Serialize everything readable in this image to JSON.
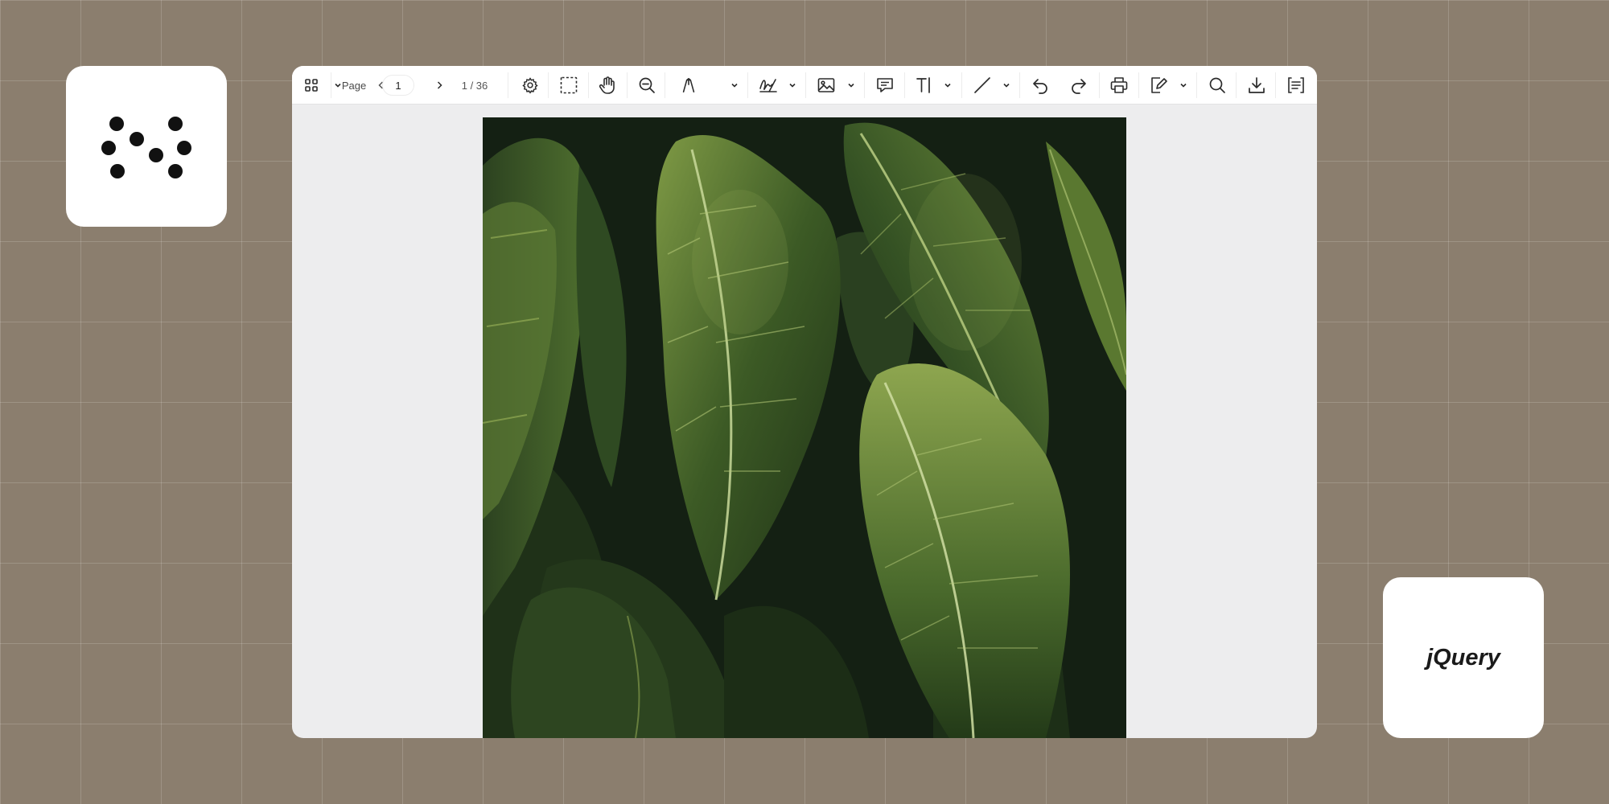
{
  "brand_right": {
    "text": "jQuery"
  },
  "toolbar": {
    "page_label": "Page",
    "page_value": "1",
    "page_total": "1 / 36",
    "icons": [
      "grid-icon",
      "chevron-down-icon",
      "chevron-left-icon",
      "chevron-right-icon",
      "gear-icon",
      "marquee-select-icon",
      "hand-icon",
      "zoom-out-icon",
      "pen-icon",
      "signature-icon",
      "image-icon",
      "comment-icon",
      "text-icon",
      "line-icon",
      "undo-icon",
      "redo-icon",
      "print-icon",
      "edit-icon",
      "search-icon",
      "download-icon",
      "sidebar-icon"
    ]
  },
  "colors": {
    "background": "#8b7e6e",
    "viewer": "#ededee",
    "toolbar": "#ffffff",
    "leaf_dark": "#1a2619",
    "leaf_mid": "#3c5a25",
    "leaf_light": "#7f9a45"
  }
}
